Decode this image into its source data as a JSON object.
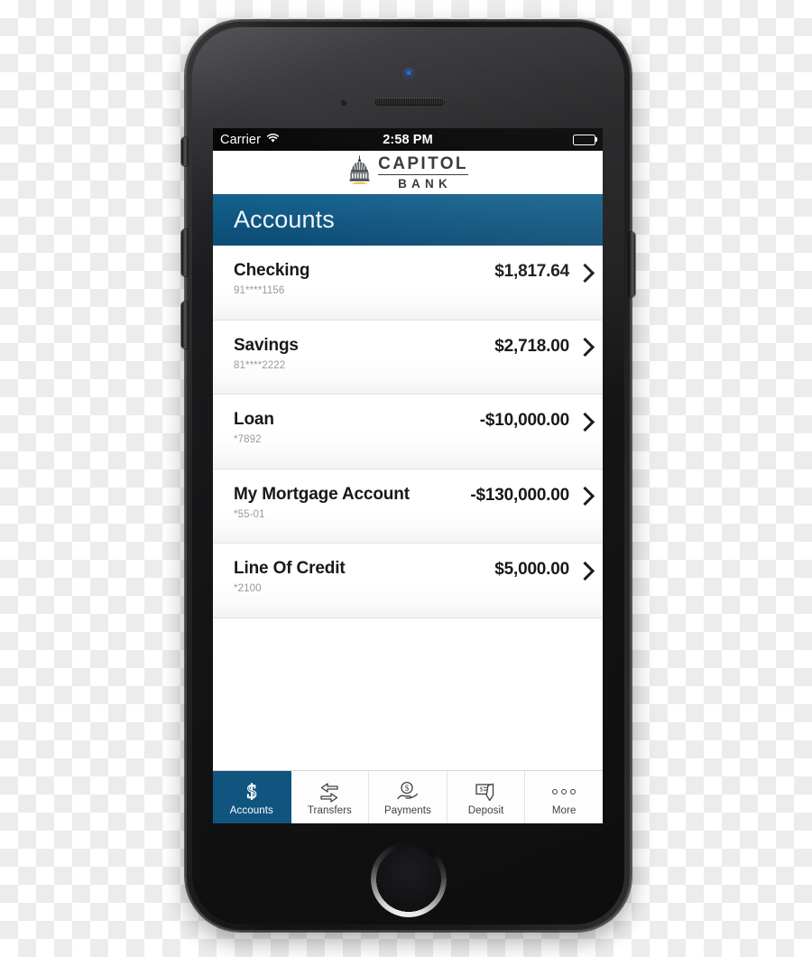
{
  "device": {
    "name": "iphone-mockup",
    "hardware": {
      "front_camera": "camera-icon",
      "earpiece": "speaker-grille",
      "proximity_sensor": "sensor-icon",
      "home_button": "home-button",
      "silent_switch": "silent-switch",
      "volume_up": "volume-up-button",
      "volume_down": "volume-down-button",
      "power": "power-button"
    }
  },
  "status_bar": {
    "carrier": "Carrier",
    "wifi_icon": "wifi-icon",
    "time": "2:58 PM",
    "battery_icon": "battery-icon",
    "battery_level": 100
  },
  "brand": {
    "logo_icon": "capitol-dome-logo",
    "name_line1": "CAPITOL",
    "name_line2": "BANK",
    "logo_color": "#2e3033",
    "logo_accent": "#f0b429"
  },
  "header": {
    "title": "Accounts",
    "background_color": "#0f5580",
    "text_color": "#f2f5f7"
  },
  "accounts": [
    {
      "name": "Checking",
      "number": "91****1156",
      "balance": "$1,817.64",
      "negative": false
    },
    {
      "name": "Savings",
      "number": "81****2222",
      "balance": "$2,718.00",
      "negative": false
    },
    {
      "name": "Loan",
      "number": "*7892",
      "balance": "-$10,000.00",
      "negative": true
    },
    {
      "name": "My Mortgage Account",
      "number": "*55-01",
      "balance": "-$130,000.00",
      "negative": true
    },
    {
      "name": "Line Of Credit",
      "number": "*2100",
      "balance": "$5,000.00",
      "negative": false
    }
  ],
  "tabbar": {
    "active_index": 0,
    "active_color": "#0f5580",
    "tabs": [
      {
        "label": "Accounts",
        "icon": "dollar-sign-icon"
      },
      {
        "label": "Transfers",
        "icon": "transfer-arrows-icon"
      },
      {
        "label": "Payments",
        "icon": "hand-coin-icon"
      },
      {
        "label": "Deposit",
        "icon": "check-deposit-icon"
      },
      {
        "label": "More",
        "icon": "ellipsis-icon"
      }
    ]
  }
}
